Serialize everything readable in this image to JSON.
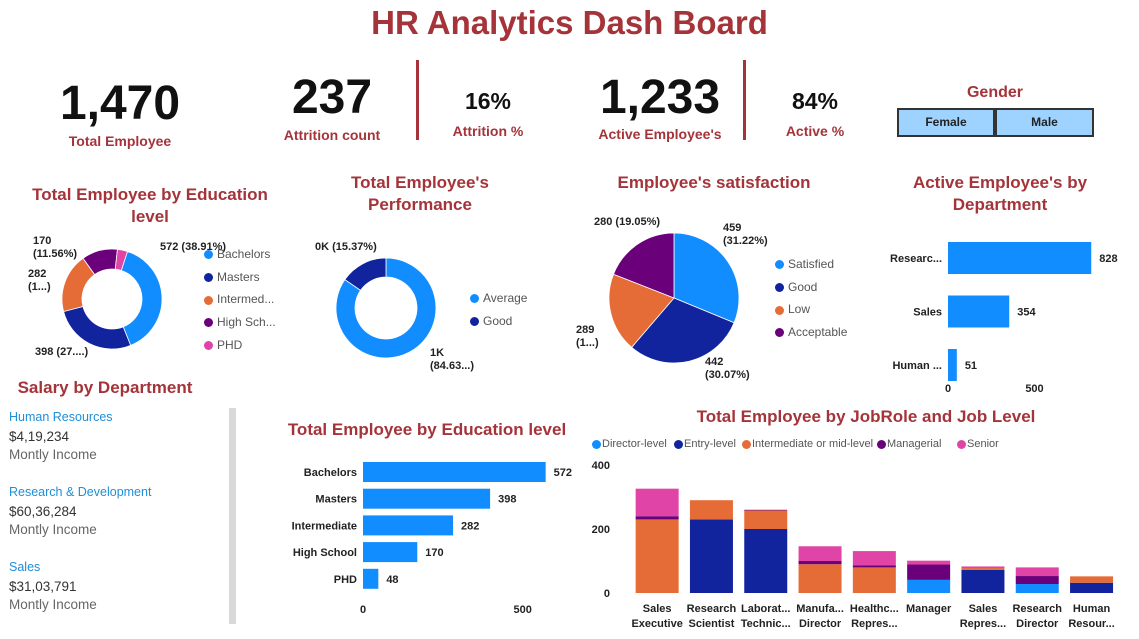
{
  "title": "HR Analytics Dash Board",
  "kpis": {
    "total_employee": {
      "value": "1,470",
      "label": "Total Employee"
    },
    "attrition_count": {
      "value": "237",
      "label": "Attrition count"
    },
    "attrition_pct": {
      "value": "16%",
      "label": "Attrition %"
    },
    "active_employees": {
      "value": "1,233",
      "label": "Active Employee's"
    },
    "active_pct": {
      "value": "84%",
      "label": "Active %"
    }
  },
  "gender": {
    "title": "Gender",
    "options": [
      "Female",
      "Male"
    ]
  },
  "colors": {
    "blue": "#118dff",
    "navy": "#12239e",
    "orange": "#e66c37",
    "purple": "#6b007b",
    "pink": "#e044a7",
    "title_red": "#a4343a"
  },
  "chart_data": [
    {
      "id": "edu_donut",
      "type": "pie",
      "variant": "donut",
      "title": "Total Employee by Education level",
      "categories": [
        "Bachelors",
        "Masters",
        "Intermed...",
        "High Sch...",
        "PHD"
      ],
      "values": [
        572,
        398,
        282,
        170,
        48
      ],
      "data_labels": [
        "572 (38.91%)",
        "398 (27....)",
        "282 (1...)",
        "170 (11.56%)",
        ""
      ],
      "legend": "right"
    },
    {
      "id": "performance_donut",
      "type": "pie",
      "variant": "donut",
      "title": "Total Employee's Performance",
      "categories": [
        "Average",
        "Good"
      ],
      "values": [
        1244,
        226
      ],
      "data_labels": [
        "1K (84.63...)",
        "0K (15.37%)"
      ],
      "legend": "right"
    },
    {
      "id": "satisfaction_pie",
      "type": "pie",
      "title": "Employee's satisfaction",
      "categories": [
        "Satisfied",
        "Good",
        "Low",
        "Acceptable"
      ],
      "values": [
        459,
        442,
        289,
        280
      ],
      "data_labels": [
        "459 (31.22%)",
        "442 (30.07%)",
        "289 (1...)",
        "280 (19.05%)"
      ],
      "legend": "right"
    },
    {
      "id": "active_by_dept",
      "type": "bar",
      "orientation": "horizontal",
      "title": "Active Employee's by Department",
      "categories": [
        "Researc...",
        "Sales",
        "Human ..."
      ],
      "values": [
        828,
        354,
        51
      ],
      "xlim": [
        0,
        900
      ],
      "xticks": [
        "0",
        "500"
      ]
    },
    {
      "id": "edu_bar",
      "type": "bar",
      "orientation": "horizontal",
      "title": "Total Employee by Education level",
      "categories": [
        "Bachelors",
        "Masters",
        "Intermediate",
        "High School",
        "PHD"
      ],
      "values": [
        572,
        398,
        282,
        170,
        48
      ],
      "xlim": [
        0,
        600
      ],
      "xticks": [
        "0",
        "500"
      ]
    },
    {
      "id": "jobrole_stacked",
      "type": "bar",
      "stacked": true,
      "title": "Total Employee by JobRole and Job Level",
      "categories": [
        "Sales Executive",
        "Research Scientist",
        "Laborat... Technic...",
        "Manufa... Director",
        "Healthc... Repres...",
        "Manager",
        "Sales Repres...",
        "Research Director",
        "Human Resour..."
      ],
      "category_lines": [
        [
          "Sales",
          "Executive"
        ],
        [
          "Research",
          "Scientist"
        ],
        [
          "Laborat...",
          "Technic..."
        ],
        [
          "Manufa...",
          "Director"
        ],
        [
          "Healthc...",
          "Repres..."
        ],
        [
          "Manager",
          ""
        ],
        [
          "Sales",
          "Repres..."
        ],
        [
          "Research",
          "Director"
        ],
        [
          "Human",
          "Resour..."
        ]
      ],
      "series": [
        {
          "name": "Director-level",
          "values": [
            0,
            0,
            0,
            0,
            0,
            41,
            0,
            28,
            0
          ]
        },
        {
          "name": "Entry-level",
          "values": [
            0,
            230,
            200,
            0,
            0,
            0,
            72,
            0,
            32
          ]
        },
        {
          "name": "Intermediate or mid-level",
          "values": [
            230,
            60,
            58,
            90,
            80,
            0,
            6,
            0,
            20
          ]
        },
        {
          "name": "Managerial",
          "values": [
            10,
            0,
            2,
            10,
            6,
            48,
            0,
            25,
            0
          ]
        },
        {
          "name": "Senior",
          "values": [
            86,
            0,
            0,
            46,
            45,
            12,
            5,
            27,
            0
          ]
        }
      ],
      "ylim": [
        0,
        400
      ],
      "yticks": [
        "0",
        "200",
        "400"
      ],
      "legend": "top-left"
    }
  ],
  "salary": {
    "title": "Salary by Department",
    "items": [
      {
        "dept": "Human Resources",
        "value": "$4,19,234",
        "sub": "Montly Income"
      },
      {
        "dept": "Research & Development",
        "value": "$60,36,284",
        "sub": "Montly Income"
      },
      {
        "dept": "Sales",
        "value": "$31,03,791",
        "sub": "Montly Income"
      }
    ]
  }
}
